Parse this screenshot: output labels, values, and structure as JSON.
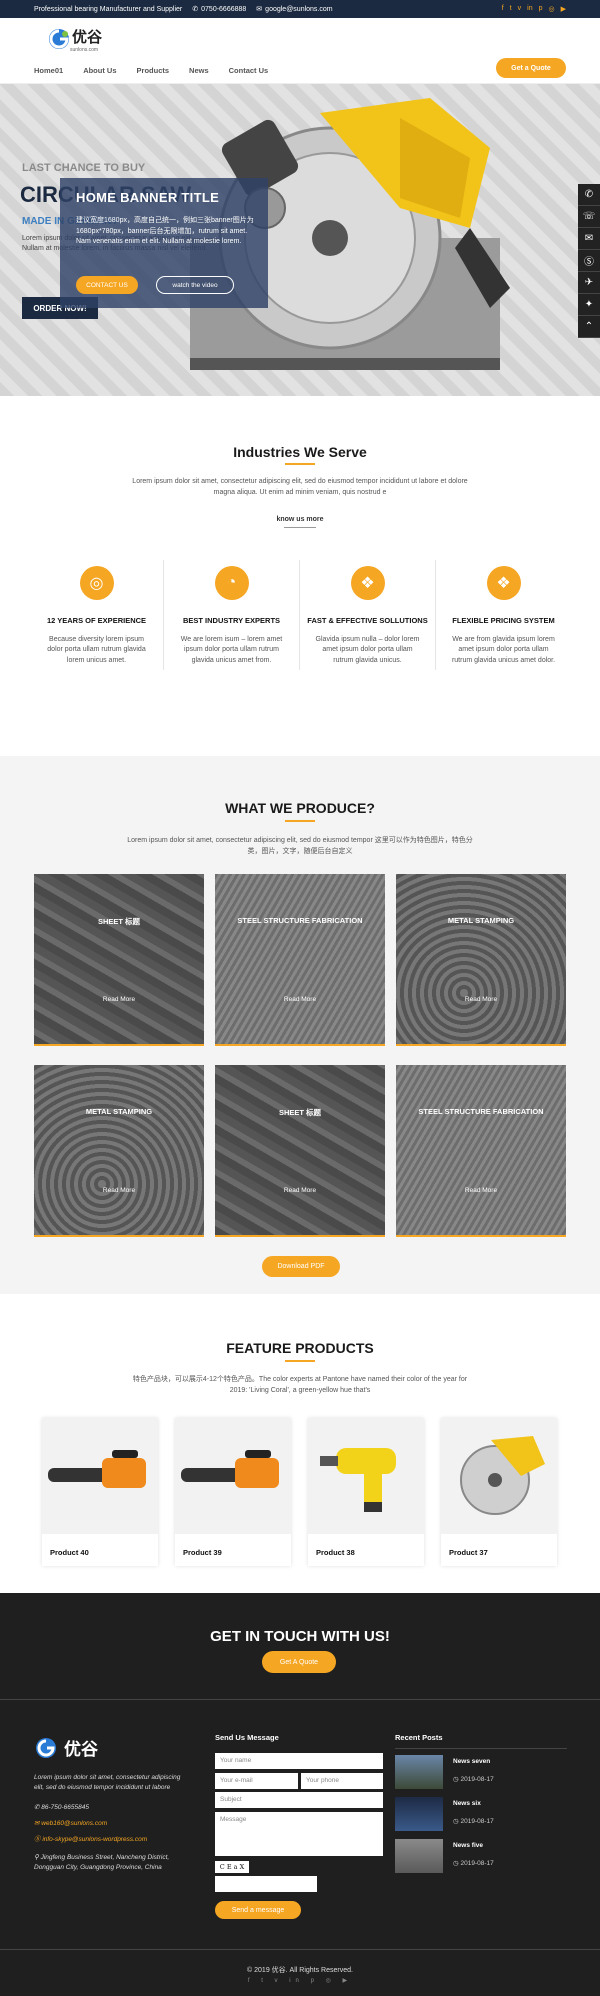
{
  "topbar": {
    "tagline": "Professional bearing Manufacturer and Supplier",
    "phone": "0750-6666888",
    "email": "google@sunlons.com",
    "social": [
      "f",
      "t",
      "v",
      "in",
      "p",
      "◎",
      "▶"
    ]
  },
  "header": {
    "logo_text": "优谷",
    "logo_sub": "sunlons.com",
    "nav": [
      "Home01",
      "About Us",
      "Products",
      "News",
      "Contact Us"
    ],
    "quote_button": "Get a Quote"
  },
  "banner": {
    "line1": "LAST CHANCE TO BUY",
    "line2": "CIRCULAR SAW",
    "line3": "MADE IN GERMANY",
    "line4": "Lorem ipsum dolor sit amet, consectetur adipiscing elit. Nullam at molestie lorem, in facilisis massa nisl vel eleifend.",
    "order_button": "ORDER NOW!",
    "overlay_title": "HOME BANNER TITLE",
    "overlay_text": "建议宽度1680px，高度自己统一，例如三张banner图片为1680px*780px，banner后台无限增加，rutrum sit amet. Nam venenatis enim et elit. Nullam at molestie lorem.",
    "contact_button": "CONTACT US",
    "video_button": "watch the video",
    "side_icons": [
      "✆",
      "☏",
      "✉",
      "Ⓢ",
      "✈",
      "✦",
      "⌃"
    ]
  },
  "industries": {
    "title": "Industries We Serve",
    "desc": "Lorem ipsum dolor sit amet, consectetur adipiscing elit, sed do eiusmod tempor incididunt ut labore et dolore magna aliqua. Ut enim ad minim veniam, quis nostrud e",
    "know_more": "know us more",
    "features": [
      {
        "icon": "aperture-icon",
        "glyph": "◎",
        "title": "12 YEARS OF EXPERIENCE",
        "text": "Because diversity lorem ipsum dolor porta ullam rutrum glavida lorem unicus amet."
      },
      {
        "icon": "gauge-icon",
        "glyph": "◔",
        "title": "BEST INDUSTRY EXPERTS",
        "text": "We are lorem isum – lorem amet ipsum dolor porta ullam rutrum glavida unicus amet from."
      },
      {
        "icon": "dropbox-icon",
        "glyph": "❖",
        "title": "FAST & EFFECTIVE SOLLUTIONS",
        "text": "Glavida ipsum nulla – dolor lorem amet ipsum dolor porta ullam rutrum glavida unicus."
      },
      {
        "icon": "dropbox-icon",
        "glyph": "❖",
        "title": "FLEXIBLE PRICING SYSTEM",
        "text": "We are from glavida ipsum lorem amet ipsum dolor porta ullam rutrum glavida unicus amet dolor."
      }
    ]
  },
  "produce": {
    "title": "WHAT WE PRODUCE?",
    "desc": "Lorem ipsum dolor sit amet, consectetur adipiscing elit, sed do eiusmod tempor 这里可以作为特色图片，特色分类，图片，文字，随便后台自定义",
    "read_more": "Read More",
    "cards": [
      "SHEET 标题",
      "STEEL STRUCTURE FABRICATION",
      "METAL STAMPING",
      "METAL STAMPING",
      "SHEET 标题",
      "STEEL STRUCTURE FABRICATION"
    ],
    "download": "Download PDF"
  },
  "products": {
    "title": "FEATURE PRODUCTS",
    "desc": "特色产品块，可以展示4-12个特色产品。The color experts at Pantone have named their color of the year for 2019: 'Living Coral', a green-yellow hue that's",
    "items": [
      "Product 40",
      "Product 39",
      "Product 38",
      "Product 37"
    ]
  },
  "contact": {
    "title": "GET IN TOUCH WITH US!",
    "button": "Get A Quote"
  },
  "footer": {
    "logo_text": "优谷",
    "about": "Lorem ipsum dolor sit amet, consectetur adipiscing elit, sed do eiusmod tempor incididunt ut labore",
    "phone": "86-750-6655845",
    "email": "web160@sunlons.com",
    "skype": "info-skype@sunlons-wordpress.com",
    "address": "Jingfeng Business Street, Nancheng District, Dongguan City, Guangdong Province, China",
    "msg_title": "Send Us Message",
    "name_ph": "Your name",
    "email_ph": "Your e-mail",
    "phone_ph": "Your phone",
    "subject_ph": "Subject",
    "message_ph": "Message",
    "captcha": "C E a X",
    "send": "Send a message",
    "posts_title": "Recent Posts",
    "posts": [
      {
        "title": "News seven",
        "date": "2019-08-17"
      },
      {
        "title": "News six",
        "date": "2019-08-17"
      },
      {
        "title": "News five",
        "date": "2019-08-17"
      }
    ],
    "copyright": "© 2019 优谷. All Rights Reserved.",
    "copyright_brand": "优谷"
  }
}
